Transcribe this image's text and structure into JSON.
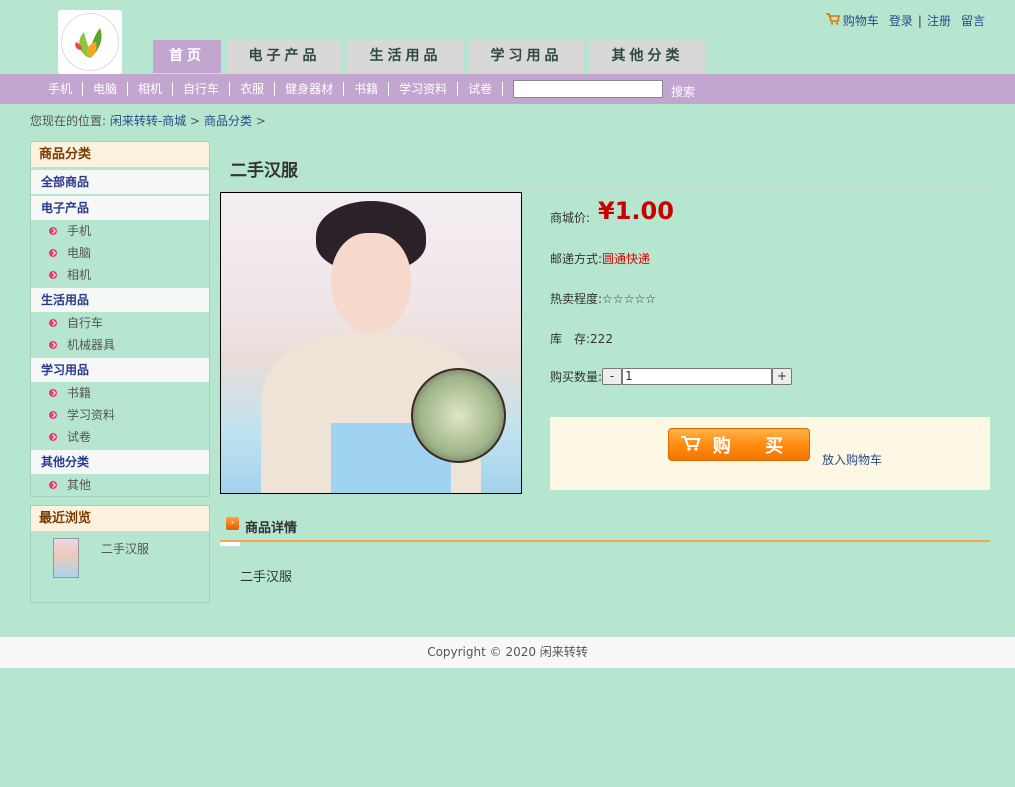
{
  "header": {
    "links": [
      {
        "label": "购物车"
      },
      {
        "label": "登录"
      },
      {
        "label": "注册"
      },
      {
        "label": "留言"
      }
    ]
  },
  "nav": {
    "tabs": [
      "首页",
      "电子产品",
      "生活用品",
      "学习用品",
      "其他分类"
    ]
  },
  "subnav": {
    "items": [
      "手机",
      "电脑",
      "相机",
      "自行车",
      "衣服",
      "健身器材",
      "书籍",
      "学习资料",
      "试卷"
    ],
    "search_value": "",
    "search_label": "搜索"
  },
  "breadcrumb": {
    "prefix": "您现在的位置:",
    "crumb1": "闲来转转-商城",
    "sep1": ">",
    "crumb2": "商品分类",
    "sep2": ">"
  },
  "sidebar": {
    "categories_title": "商品分类",
    "all_label": "全部商品",
    "groups": [
      {
        "name": "电子产品",
        "items": [
          "手机",
          "电脑",
          "相机"
        ]
      },
      {
        "name": "生活用品",
        "items": [
          "自行车",
          "机械器具"
        ]
      },
      {
        "name": "学习用品",
        "items": [
          "书籍",
          "学习资料",
          "试卷"
        ]
      },
      {
        "name": "其他分类",
        "items": [
          "其他"
        ]
      }
    ],
    "recent_title": "最近浏览",
    "recent_item": "二手汉服"
  },
  "product": {
    "title": "二手汉服",
    "price_label": "商城价:",
    "price": "¥1.00",
    "shipping_label": "邮递方式:",
    "shipping_value": "圆通快递",
    "hot_label": "热卖程度:",
    "hot_value": "☆☆☆☆☆",
    "stock_label": "库　存:",
    "stock_value": "222",
    "qty_label": "购买数量:",
    "qty_minus": "-",
    "qty_value": "1",
    "qty_plus": "+",
    "buy_label": "购 买",
    "add_cart_label": "放入购物车",
    "detail_title": "商品详情",
    "detail_text": "二手汉服"
  },
  "footer": {
    "copyright": "Copyright © 2020 闲来转转"
  },
  "colors": {
    "background": "#b6e6cf",
    "nav_active": "#c2a6cf",
    "price": "#c80000",
    "buy_button": "#ff8a0d"
  }
}
